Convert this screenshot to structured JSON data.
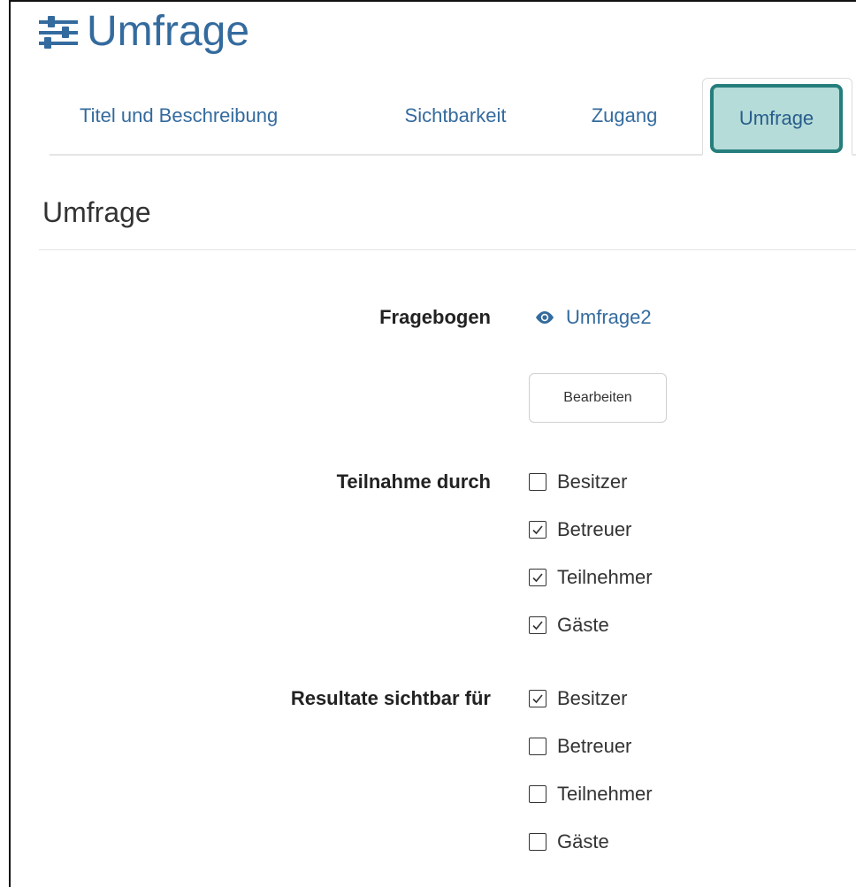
{
  "header": {
    "title": "Umfrage",
    "icon": "sliders-icon"
  },
  "tabs": [
    {
      "label": "Titel und Beschreibung",
      "active": false
    },
    {
      "label": "Sichtbarkeit",
      "active": false
    },
    {
      "label": "Zugang",
      "active": false
    },
    {
      "label": "Umfrage",
      "active": true
    }
  ],
  "section": {
    "title": "Umfrage"
  },
  "form": {
    "fragebogen": {
      "label": "Fragebogen",
      "link_text": "Umfrage2",
      "edit_button": "Bearbeiten"
    },
    "teilnahme": {
      "label": "Teilnahme durch",
      "options": [
        {
          "label": "Besitzer",
          "checked": false
        },
        {
          "label": "Betreuer",
          "checked": true
        },
        {
          "label": "Teilnehmer",
          "checked": true
        },
        {
          "label": "Gäste",
          "checked": true
        }
      ]
    },
    "resultate": {
      "label": "Resultate sichtbar für",
      "options": [
        {
          "label": "Besitzer",
          "checked": true
        },
        {
          "label": "Betreuer",
          "checked": false
        },
        {
          "label": "Teilnehmer",
          "checked": false
        },
        {
          "label": "Gäste",
          "checked": false
        }
      ]
    }
  },
  "colors": {
    "link": "#346b9e",
    "highlight_fill": "#b5dcd8",
    "highlight_border": "#267e7c"
  }
}
